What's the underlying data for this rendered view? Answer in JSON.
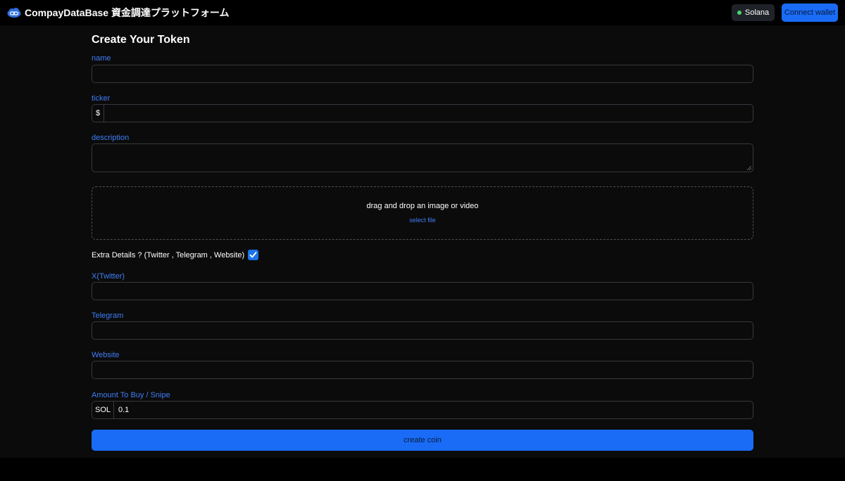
{
  "header": {
    "title": "CompayDataBase 資金調達プラットフォーム",
    "logo_icon": "link-cloud-icon",
    "chain_label": "Solana",
    "connect_label": "Connect wallet"
  },
  "form": {
    "heading": "Create Your Token",
    "name": {
      "label": "name",
      "value": ""
    },
    "ticker": {
      "label": "ticker",
      "prefix": "$",
      "value": ""
    },
    "description": {
      "label": "description",
      "value": ""
    },
    "upload": {
      "text": "drag and drop an image or video",
      "link": "select file"
    },
    "extra": {
      "label": "Extra Details ? (Twitter , Telegram , Website)",
      "checked": true
    },
    "twitter": {
      "label": "X(Twitter)",
      "value": ""
    },
    "telegram": {
      "label": "Telegram",
      "value": ""
    },
    "website": {
      "label": "Website",
      "value": ""
    },
    "amount": {
      "label": "Amount To Buy / Snipe",
      "prefix": "SOL",
      "value": "0.1"
    },
    "submit_label": "create coin"
  },
  "colors": {
    "accent": "#1a6cf6",
    "label": "#3f7ef7",
    "background": "#0b0b0b",
    "status_dot": "#46d46c"
  }
}
